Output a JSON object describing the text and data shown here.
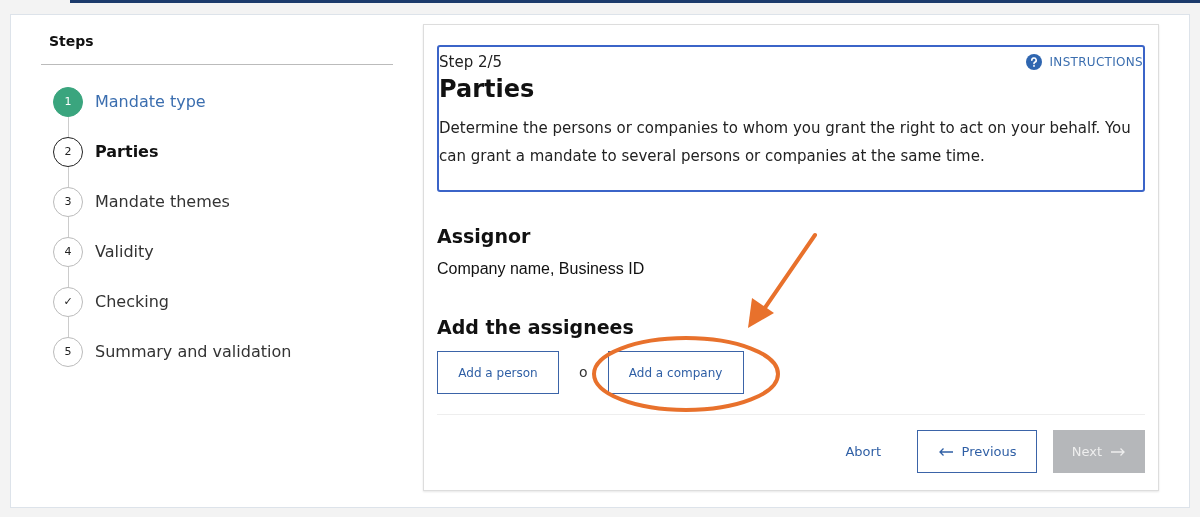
{
  "steps_panel": {
    "title": "Steps",
    "steps": [
      {
        "marker": "1",
        "label": "Mandate type",
        "done": true,
        "selected": false
      },
      {
        "marker": "2",
        "label": "Parties",
        "done": false,
        "selected": true
      },
      {
        "marker": "3",
        "label": "Mandate themes",
        "done": false,
        "selected": false
      },
      {
        "marker": "4",
        "label": "Validity",
        "done": false,
        "selected": false
      },
      {
        "marker": "✓",
        "label": "Checking",
        "done": false,
        "selected": false
      },
      {
        "marker": "5",
        "label": "Summary and validation",
        "done": false,
        "selected": false
      }
    ]
  },
  "header": {
    "step_counter": "Step 2/5",
    "instructions_link": "INSTRUCTIONS",
    "title": "Parties",
    "description": "Determine the persons or companies to whom you grant the right to act on your behalf. You can grant a mandate to several persons or companies at the same time."
  },
  "assignor": {
    "heading": "Assignor",
    "value": "Company name, Business ID"
  },
  "assignees": {
    "heading": "Add the assignees",
    "add_person": "Add a person",
    "separator": "o",
    "add_company": "Add a company"
  },
  "footer": {
    "abort": "Abort",
    "previous": "Previous",
    "next": {
      "label": "Next",
      "disabled": true
    }
  }
}
